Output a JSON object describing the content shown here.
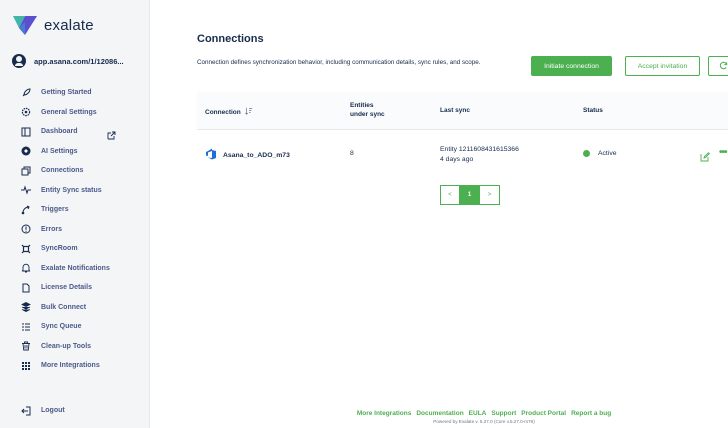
{
  "brand": {
    "name": "exalate",
    "colors": {
      "accent": "#4caf50",
      "logo_teal": "#3fb6a8",
      "logo_purple": "#5a4fcf",
      "text": "#172b4d",
      "nav_text": "#4c5a8a"
    }
  },
  "account": {
    "name": "app.asana.com/1/12086..."
  },
  "nav": {
    "items": [
      {
        "label": "Getting Started",
        "icon": "rocket-icon"
      },
      {
        "label": "General Settings",
        "icon": "gear-icon"
      },
      {
        "label": "Dashboard",
        "icon": "dashboard-icon"
      },
      {
        "label": "AI Settings",
        "icon": "ai-icon"
      },
      {
        "label": "Connections",
        "icon": "connections-icon"
      },
      {
        "label": "Entity Sync status",
        "icon": "pulse-icon"
      },
      {
        "label": "Triggers",
        "icon": "trigger-icon"
      },
      {
        "label": "Errors",
        "icon": "error-icon"
      },
      {
        "label": "SyncRoom",
        "icon": "syncroom-icon"
      },
      {
        "label": "Exalate Notifications",
        "icon": "bell-icon"
      },
      {
        "label": "License Details",
        "icon": "document-icon"
      },
      {
        "label": "Bulk Connect",
        "icon": "stack-icon"
      },
      {
        "label": "Sync Queue",
        "icon": "queue-icon"
      },
      {
        "label": "Clean-up Tools",
        "icon": "trash-icon"
      },
      {
        "label": "More Integrations",
        "icon": "grid-icon"
      }
    ],
    "logout": "Logout"
  },
  "main": {
    "title": "Connections",
    "description": "Connection defines synchronization behavior, including communication details, sync rules, and scope.",
    "buttons": {
      "initiate": "Initiate connection",
      "accept": "Accept invitation"
    },
    "table": {
      "headers": {
        "connection": "Connection",
        "entities_line1": "Entities",
        "entities_line2": "under sync",
        "last_sync": "Last sync",
        "status": "Status"
      },
      "rows": [
        {
          "name": "Asana_to_ADO_m73",
          "entities": "8",
          "last_sync_line1": "Entity 1211608431615366",
          "last_sync_line2": "4 days ago",
          "status": "Active"
        }
      ]
    },
    "pagination": {
      "prev": "<",
      "current": "1",
      "next": ">"
    }
  },
  "footer": {
    "links": [
      "More Integrations",
      "Documentation",
      "EULA",
      "Support",
      "Product Portal",
      "Report a bug"
    ],
    "powered": "Powered by Exalate v. 5.27.0 (Core v.5.27.0-m76)"
  }
}
